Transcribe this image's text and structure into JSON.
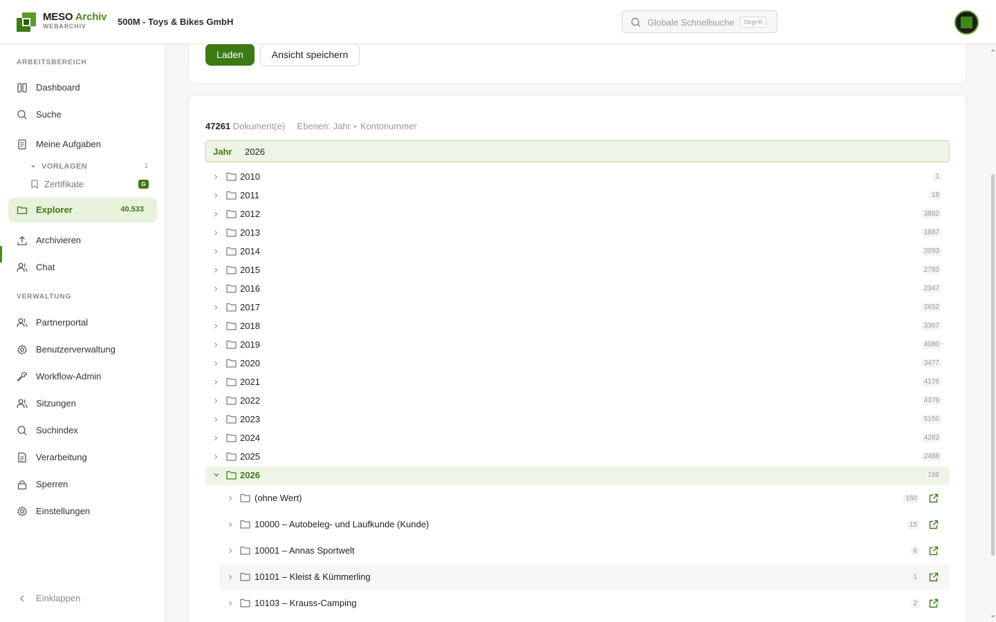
{
  "header": {
    "brand_main": "MESO",
    "brand_accent": "Archiv",
    "brand_sub": "WEBARCHIV",
    "tenant": "500M - Toys & Bikes GmbH",
    "search_placeholder": "Globale Schnellsuche",
    "search_shortcut": "Strg+K"
  },
  "sidebar": {
    "section_work": "ARBEITSBEREICH",
    "section_admin": "VERWALTUNG",
    "items": {
      "dashboard": "Dashboard",
      "suche": "Suche",
      "aufgaben": "Meine Aufgaben",
      "explorer": "Explorer",
      "archivieren": "Archivieren",
      "chat": "Chat",
      "partnerportal": "Partnerportal",
      "benutzer": "Benutzerverwaltung",
      "workflow": "Workflow-Admin",
      "sitzungen": "Sitzungen",
      "suchindex": "Suchindex",
      "verarbeitung": "Verarbeitung",
      "sperren": "Sperren",
      "einstellungen": "Einstellungen"
    },
    "explorer_count": "40.533",
    "vorlagen_label": "VORLAGEN",
    "vorlagen_count": "1",
    "zertifikate_label": "Zertifikate",
    "zertifikate_badge": "G",
    "collapse_label": "Einklappen"
  },
  "toolbar": {
    "load_label": "Laden",
    "save_view_label": "Ansicht speichern"
  },
  "explorer": {
    "doc_count": "47261",
    "doc_suffix": "Dokument(e)",
    "levels_prefix": "Ebenen: Jahr",
    "levels_second": "Kontonummer",
    "breadcrumb_root": "Jahr",
    "breadcrumb_current": "2026",
    "years": [
      {
        "label": "2010",
        "count": "1"
      },
      {
        "label": "2011",
        "count": "18"
      },
      {
        "label": "2012",
        "count": "3882"
      },
      {
        "label": "2013",
        "count": "1887"
      },
      {
        "label": "2014",
        "count": "2093"
      },
      {
        "label": "2015",
        "count": "2783"
      },
      {
        "label": "2016",
        "count": "2347"
      },
      {
        "label": "2017",
        "count": "2652"
      },
      {
        "label": "2018",
        "count": "3367"
      },
      {
        "label": "2019",
        "count": "4080"
      },
      {
        "label": "2020",
        "count": "3477"
      },
      {
        "label": "2021",
        "count": "4176"
      },
      {
        "label": "2022",
        "count": "4379"
      },
      {
        "label": "2023",
        "count": "5150"
      },
      {
        "label": "2024",
        "count": "4283"
      },
      {
        "label": "2025",
        "count": "2488"
      },
      {
        "label": "2026",
        "count": "198"
      }
    ],
    "children": [
      {
        "label": "(ohne Wert)",
        "count": "150"
      },
      {
        "label": "10000 – Autobeleg- und Laufkunde (Kunde)",
        "count": "15"
      },
      {
        "label": "10001 – Annas Sportwelt",
        "count": "6"
      },
      {
        "label": "10101 – Kleist & Kümmerling",
        "count": "1"
      },
      {
        "label": "10103 – Krauss-Camping",
        "count": "2"
      }
    ]
  },
  "colors": {
    "accent": "#3d7a14",
    "accent_light": "#e7f1dc",
    "breadcrumb_bg": "#eef5e6"
  }
}
